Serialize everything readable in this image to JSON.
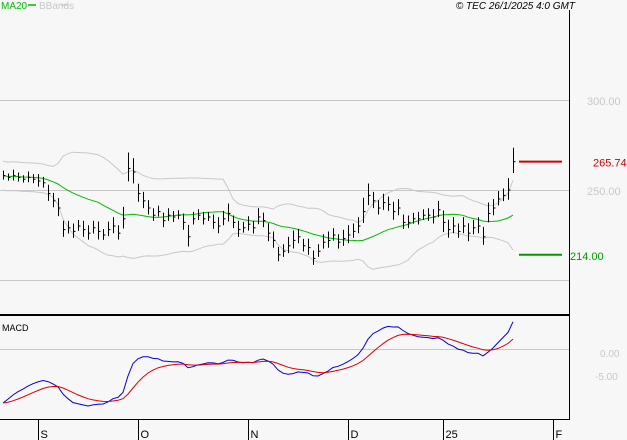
{
  "header": {
    "legend": [
      {
        "label": "MA20",
        "color": "#00bb00"
      },
      {
        "label": "BBands",
        "color": "#c8c8c8"
      }
    ],
    "copyright": "© TEC 26/1/2025 4:0 GMT"
  },
  "chart_data": {
    "type": "ohlc",
    "price_axis": {
      "range": [
        190,
        310
      ],
      "ticks": [
        {
          "value": 300,
          "label": "300.00"
        },
        {
          "value": 250,
          "label": "250.00"
        }
      ],
      "gridlines": [
        300,
        250,
        200
      ]
    },
    "levels": [
      {
        "value": 265.74,
        "label": "265.74",
        "color": "#cc0000"
      },
      {
        "value": 214.0,
        "label": "214.00",
        "color": "#009900"
      }
    ],
    "x_labels": [
      {
        "index": 7,
        "label": "S"
      },
      {
        "index": 27,
        "label": "O"
      },
      {
        "index": 49,
        "label": "N"
      },
      {
        "index": 69,
        "label": "D"
      },
      {
        "index": 88,
        "label": "25"
      },
      {
        "index": 110,
        "label": "F"
      }
    ],
    "close": [
      258,
      257,
      258,
      257,
      256,
      257,
      256,
      255,
      254,
      248,
      244,
      240,
      228,
      229,
      227,
      230,
      228,
      226,
      229,
      227,
      225,
      228,
      230,
      226,
      234,
      262,
      260,
      248,
      244,
      240,
      236,
      238,
      233,
      236,
      235,
      236,
      232,
      224,
      234,
      236,
      234,
      235,
      232,
      230,
      234,
      237,
      232,
      228,
      229,
      231,
      229,
      235,
      233,
      226,
      222,
      214,
      216,
      219,
      222,
      224,
      219,
      218,
      212,
      216,
      221,
      222,
      225,
      221,
      223,
      225,
      227,
      230,
      238,
      247,
      244,
      240,
      243,
      242,
      238,
      240,
      232,
      232,
      234,
      234,
      236,
      236,
      235,
      239,
      232,
      228,
      230,
      227,
      230,
      226,
      229,
      230,
      224,
      237,
      240,
      245,
      247,
      250,
      265.74
    ],
    "range": [
      5,
      4,
      6,
      5,
      4,
      6,
      5,
      7,
      6,
      9,
      8,
      10,
      9,
      7,
      8,
      6,
      9,
      8,
      7,
      10,
      6,
      8,
      9,
      8,
      12,
      16,
      14,
      10,
      9,
      8,
      7,
      6,
      8,
      7,
      6,
      5,
      9,
      12,
      7,
      6,
      7,
      5,
      8,
      9,
      8,
      10,
      7,
      9,
      6,
      8,
      7,
      9,
      8,
      10,
      9,
      8,
      7,
      9,
      10,
      8,
      7,
      9,
      8,
      7,
      8,
      9,
      7,
      8,
      9,
      10,
      8,
      9,
      14,
      12,
      9,
      8,
      9,
      8,
      10,
      9,
      8,
      7,
      6,
      7,
      6,
      7,
      8,
      9,
      12,
      10,
      9,
      8,
      9,
      10,
      8,
      9,
      10,
      11,
      9,
      8,
      7,
      12,
      14
    ],
    "ma_period": 20,
    "macd": {
      "title": "MACD",
      "ticks": [
        {
          "value": 0,
          "label": "0.00"
        },
        {
          "value": -5,
          "label": "-5.00"
        }
      ],
      "macd_color": "#0000dd",
      "signal_color": "#dd0000"
    }
  }
}
